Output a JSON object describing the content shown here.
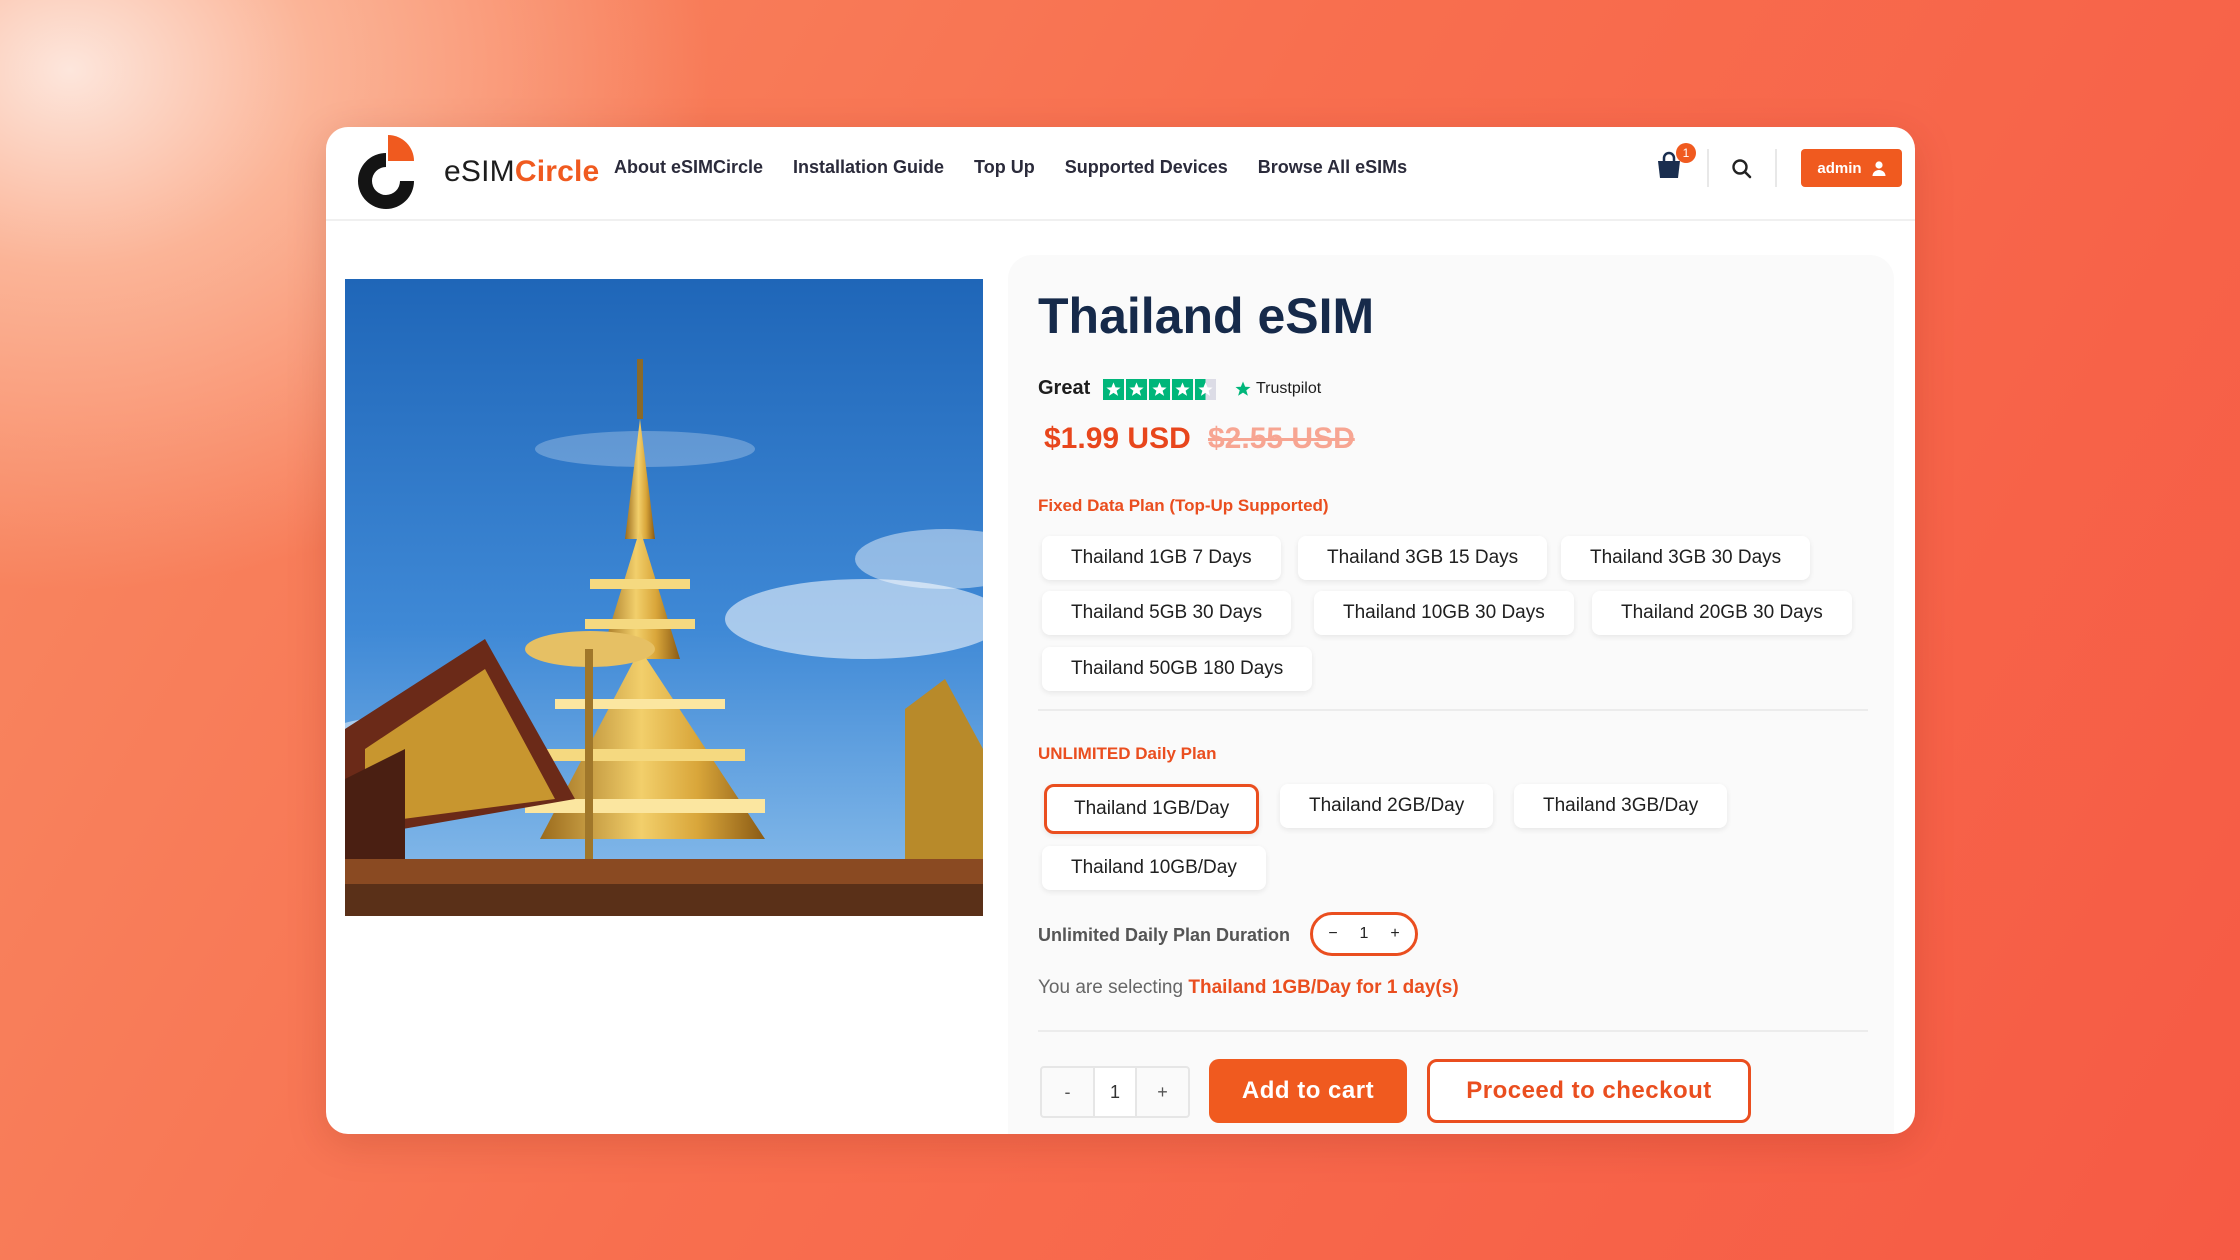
{
  "brand": {
    "logo_text_plain": "eSIM",
    "logo_text_bold": "Circle",
    "accent": "#f05a1f"
  },
  "nav": {
    "items": [
      {
        "label": "About eSIMCircle"
      },
      {
        "label": "Installation Guide"
      },
      {
        "label": "Top Up"
      },
      {
        "label": "Supported Devices"
      },
      {
        "label": "Browse All eSIMs"
      }
    ]
  },
  "header": {
    "cart_count": "1",
    "admin_label": "admin",
    "icons": [
      "shopping-bag-icon",
      "search-icon",
      "user-icon"
    ]
  },
  "product": {
    "title": "Thailand eSIM",
    "rating_text": "Great",
    "rating_stars": 4.5,
    "rating_source": "Trustpilot",
    "price": "$1.99 USD",
    "old_price": "$2.55 USD",
    "image_alt": "temple photo"
  },
  "fixed_plans": {
    "label": "Fixed Data Plan (Top-Up Supported)",
    "options": [
      "Thailand 1GB 7 Days",
      "Thailand 3GB 15 Days",
      "Thailand 3GB 30 Days",
      "Thailand 5GB 30 Days",
      "Thailand 10GB 30 Days",
      "Thailand 20GB 30 Days",
      "Thailand 50GB 180 Days"
    ]
  },
  "unlimited_plans": {
    "label": "UNLIMITED Daily Plan",
    "selected": "Thailand 1GB/Day",
    "options": [
      "Thailand 1GB/Day",
      "Thailand 2GB/Day",
      "Thailand 3GB/Day",
      "Thailand 10GB/Day"
    ]
  },
  "duration": {
    "label": "Unlimited Daily Plan Duration",
    "minus": "−",
    "value": "1",
    "plus": "+"
  },
  "selection": {
    "prefix": "You are selecting",
    "summary": "Thailand 1GB/Day for 1 day(s)"
  },
  "cart": {
    "qty_minus": "-",
    "qty_value": "1",
    "qty_plus": "+",
    "add_to_cart": "Add to cart",
    "checkout": "Proceed to checkout"
  }
}
